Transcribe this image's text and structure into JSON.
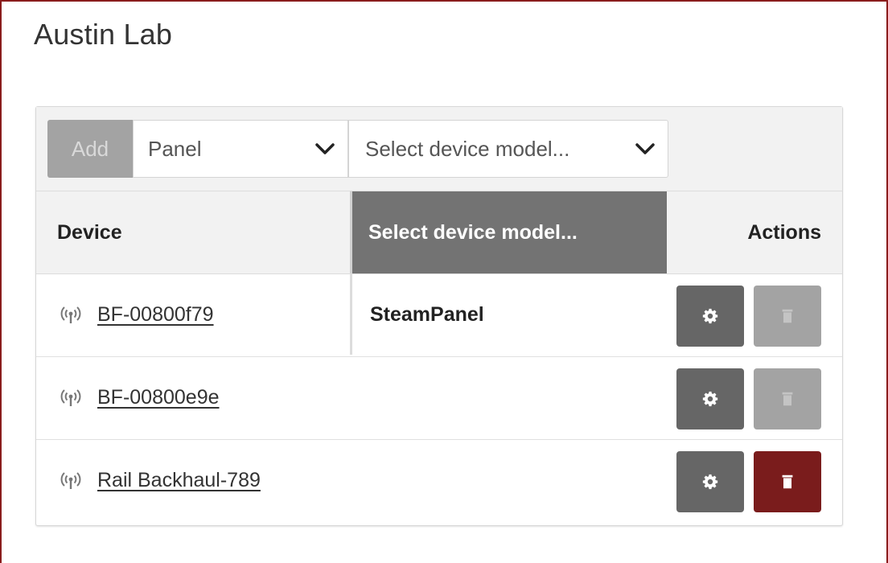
{
  "page": {
    "title": "Austin Lab"
  },
  "toolbar": {
    "add_label": "Add",
    "type_select": {
      "value": "Panel",
      "options_visible": [
        "Panel"
      ]
    },
    "model_select": {
      "placeholder": "Select device model..."
    }
  },
  "table": {
    "columns": [
      "Device",
      "Select device model...",
      "Actions"
    ],
    "rows": [
      {
        "device": "BF-00800f79",
        "model": "SteamPanel",
        "delete_enabled": false
      },
      {
        "device": "BF-00800e9e",
        "model": "",
        "delete_enabled": false
      },
      {
        "device": "Rail Backhaul-789",
        "model": "",
        "delete_enabled": true
      }
    ]
  },
  "icons": {
    "device": "wireless-signal-icon",
    "settings": "gear-icon",
    "delete": "trash-icon",
    "dropdown": "chevron-down-icon"
  },
  "colors": {
    "frame_border": "#8a1c1c",
    "add_button": "#a3a3a3",
    "header_highlight": "#737373",
    "settings_button": "#666666",
    "delete_disabled": "#a3a3a3",
    "delete_active": "#7a1c1c"
  }
}
